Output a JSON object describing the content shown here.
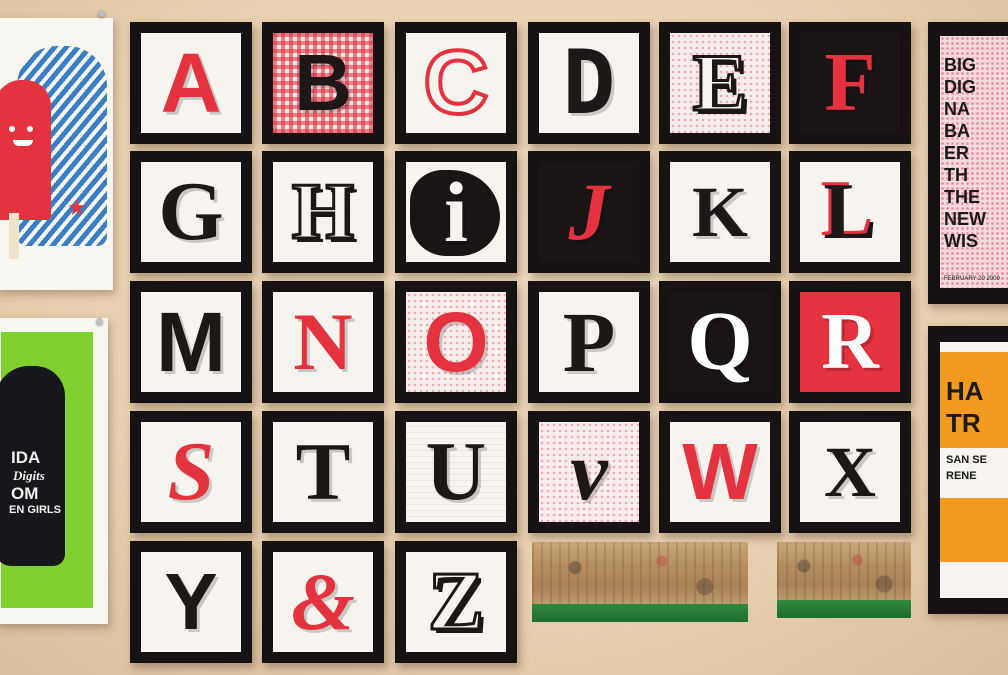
{
  "tiles": [
    {
      "letter": "A"
    },
    {
      "letter": "B"
    },
    {
      "letter": "C"
    },
    {
      "letter": "D"
    },
    {
      "letter": "E"
    },
    {
      "letter": "F"
    },
    {
      "letter": "G"
    },
    {
      "letter": "H"
    },
    {
      "letter": "i"
    },
    {
      "letter": "J"
    },
    {
      "letter": "K"
    },
    {
      "letter": "L"
    },
    {
      "letter": "M"
    },
    {
      "letter": "N"
    },
    {
      "letter": "O"
    },
    {
      "letter": "P"
    },
    {
      "letter": "Q"
    },
    {
      "letter": "R"
    },
    {
      "letter": "S"
    },
    {
      "letter": "T"
    },
    {
      "letter": "U"
    },
    {
      "letter": "v"
    },
    {
      "letter": "W"
    },
    {
      "letter": "X"
    },
    {
      "letter": "Y"
    },
    {
      "letter": "&"
    },
    {
      "letter": "Z"
    }
  ],
  "left_poster_bottom": {
    "lines": [
      "IDA",
      "Digits",
      "OM",
      "EN GIRLS"
    ]
  },
  "right_poster_top": {
    "lines": [
      "BIG",
      "DIG",
      "NA",
      "BA",
      "ER",
      "TH",
      "THE",
      "NEW",
      "WIS"
    ],
    "footer": "FEBRUARY 20 2009"
  },
  "right_poster_bottom": {
    "lines": [
      "HA",
      "TR"
    ],
    "sub": [
      "SAN SE",
      "RENE"
    ]
  },
  "colors": {
    "wall": "#e9d3b4",
    "frame": "#161213",
    "accent_red": "#e4323f",
    "ink": "#1d1718",
    "poster_green": "#7fcf2e",
    "poster_blue": "#3a7fc4",
    "poster_orange": "#f29a1f",
    "squeegee_blade": "#2f8a3c"
  },
  "icons": [
    "star-icon",
    "bone-icon",
    "crown-icon",
    "fingerprint-icon"
  ]
}
